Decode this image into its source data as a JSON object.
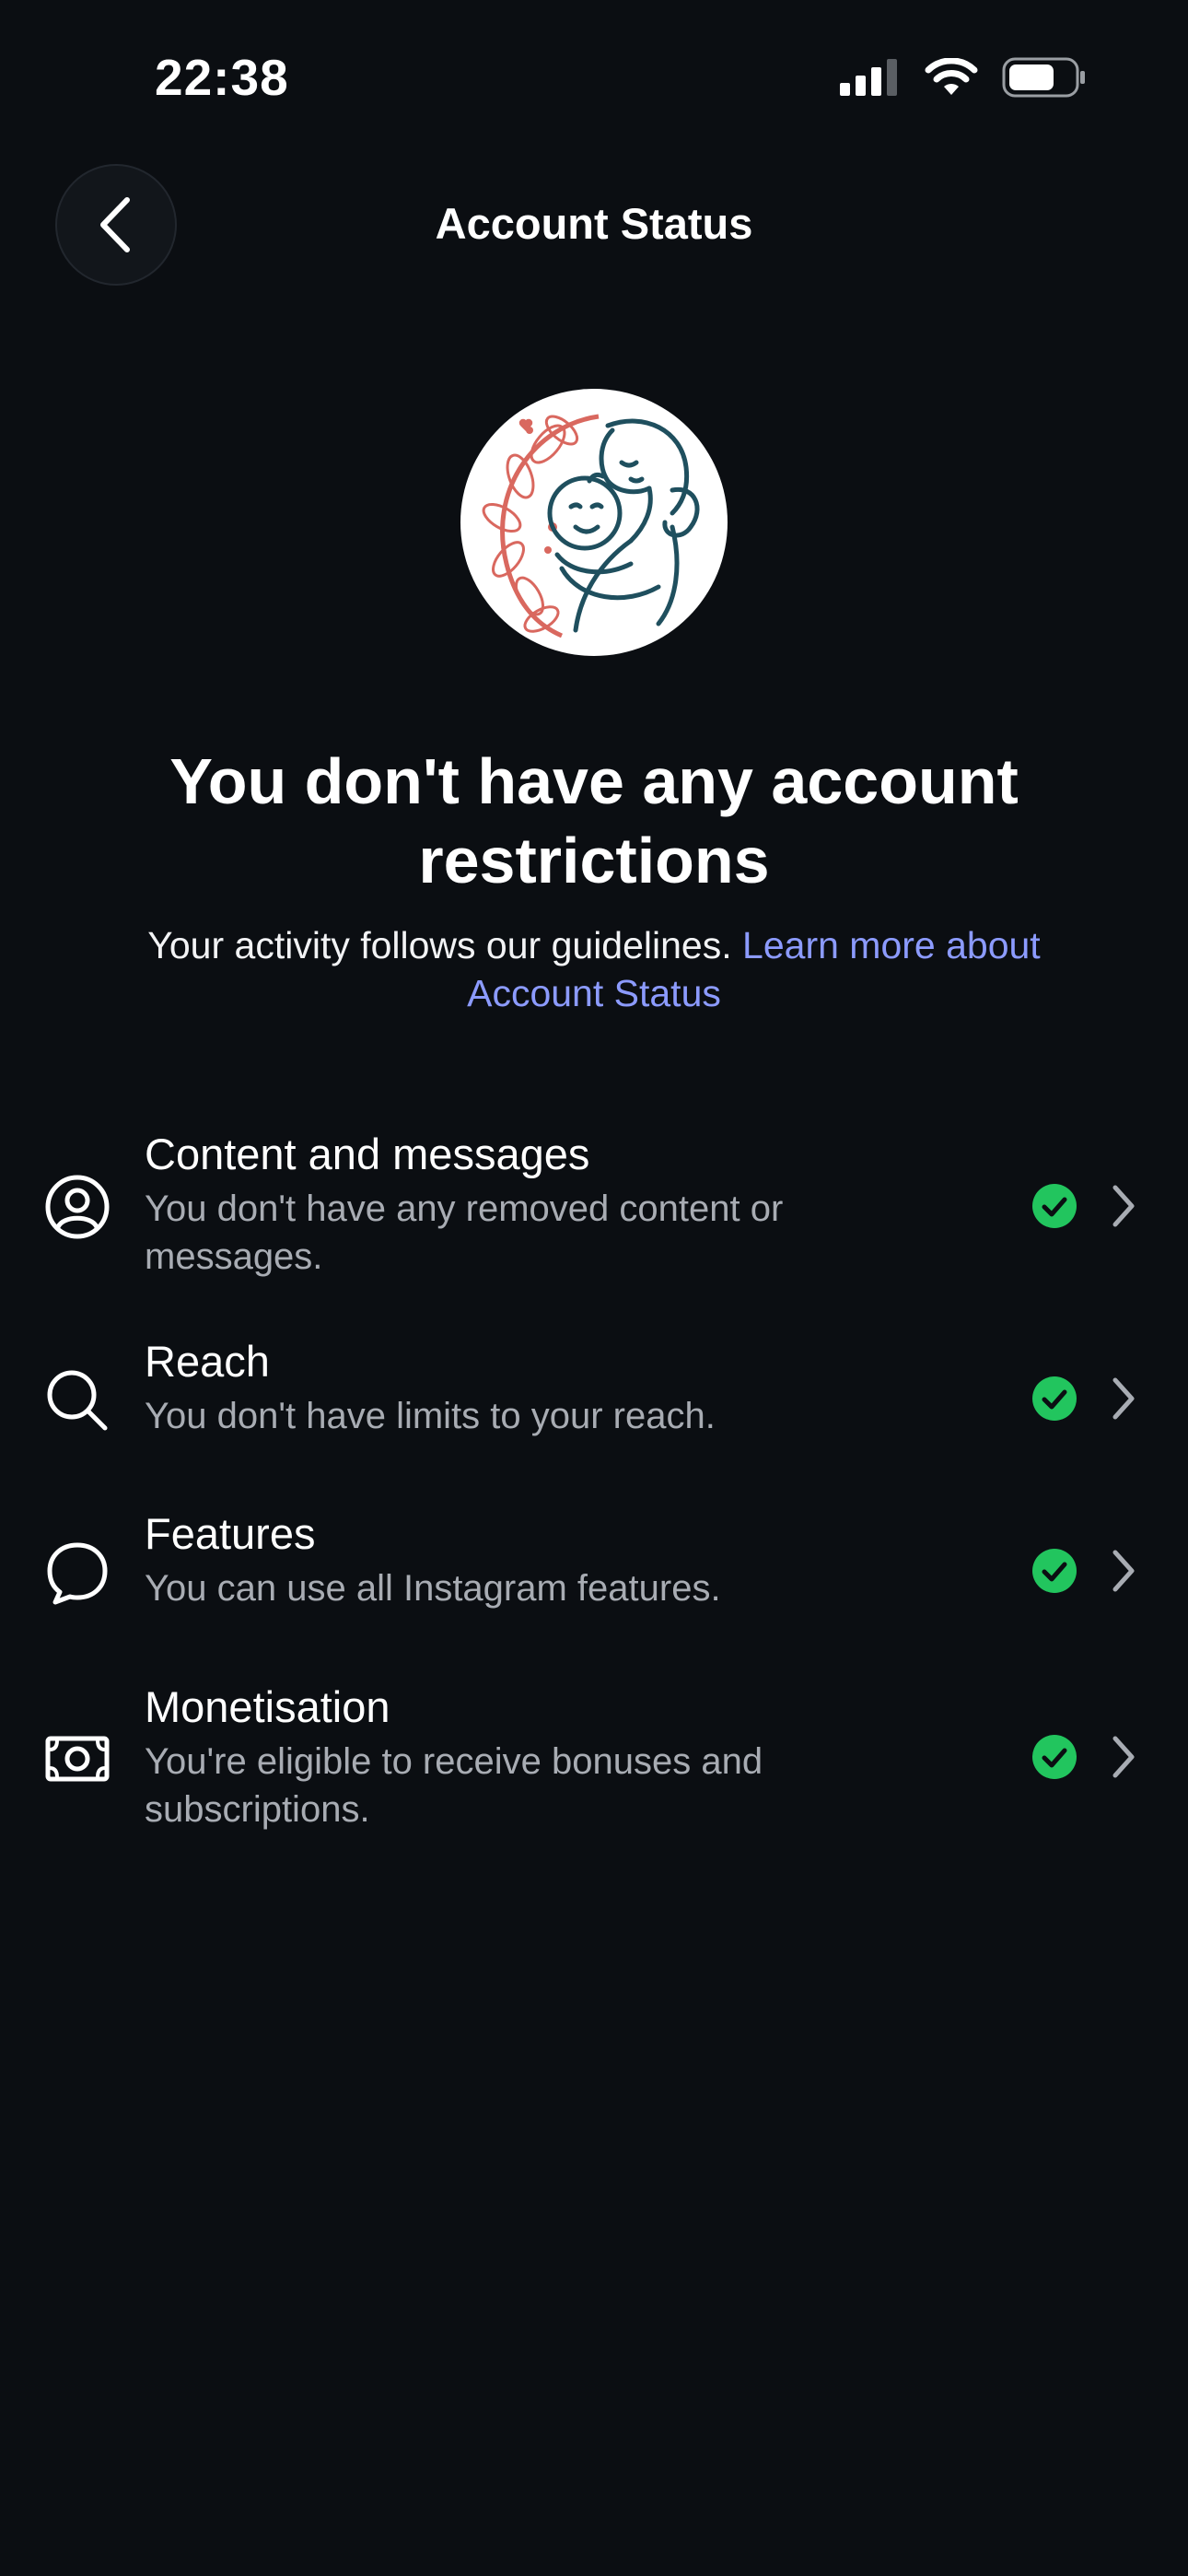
{
  "status_bar": {
    "time": "22:38",
    "icons": [
      "cellular-signal-icon",
      "wifi-icon",
      "battery-icon"
    ]
  },
  "header": {
    "title": "Account Status",
    "back_icon": "chevron-left-icon"
  },
  "profile": {
    "avatar_icon": "mother-and-baby-illustration"
  },
  "summary": {
    "headline": "You don't have any account restrictions",
    "subtext": "Your activity follows our guidelines.",
    "link_text": "Learn more about Account Status"
  },
  "items": [
    {
      "title": "Content and messages",
      "description": "You don't have any removed content or messages.",
      "icon": "user-circle-icon",
      "status": "ok"
    },
    {
      "title": "Reach",
      "description": "You don't have limits to your reach.",
      "icon": "search-icon",
      "status": "ok"
    },
    {
      "title": "Features",
      "description": "You can use all Instagram features.",
      "icon": "speech-bubble-icon",
      "status": "ok"
    },
    {
      "title": "Monetisation",
      "description": "You're eligible to receive bonuses and subscriptions.",
      "icon": "banknote-icon",
      "status": "ok"
    }
  ],
  "colors": {
    "background": "#0b0e12",
    "link": "#8c9bff",
    "check": "#22c55e",
    "secondary_text": "#a8acb3"
  }
}
